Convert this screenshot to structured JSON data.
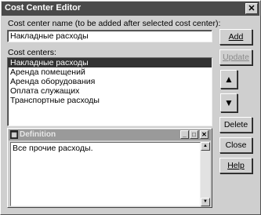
{
  "window": {
    "title": "Cost Center Editor",
    "close_glyph": "✕"
  },
  "name_field": {
    "label": "Cost center name (to be added after selected cost center):",
    "value": "Накладные расходы"
  },
  "list": {
    "label": "Cost centers:",
    "items": [
      "Накладные расходы",
      "Аренда помещений",
      "Аренда оборудования",
      "Оплата служащих",
      "Транспортные расходы"
    ],
    "selected_index": 0
  },
  "buttons": {
    "add": "Add",
    "update": "Update",
    "up_glyph": "▲",
    "down_glyph": "▼",
    "delete": "Delete",
    "close": "Close",
    "help": "Help"
  },
  "definition": {
    "title": "Definition",
    "text": "Все прочие расходы.",
    "minimize_glyph": "_",
    "maximize_glyph": "□",
    "close_glyph": "✕",
    "scroll_up_glyph": "▲",
    "scroll_down_glyph": "▼"
  },
  "icons": {
    "definition_window": "window-icon",
    "up": "arrow-up-icon",
    "down": "arrow-down-icon"
  }
}
